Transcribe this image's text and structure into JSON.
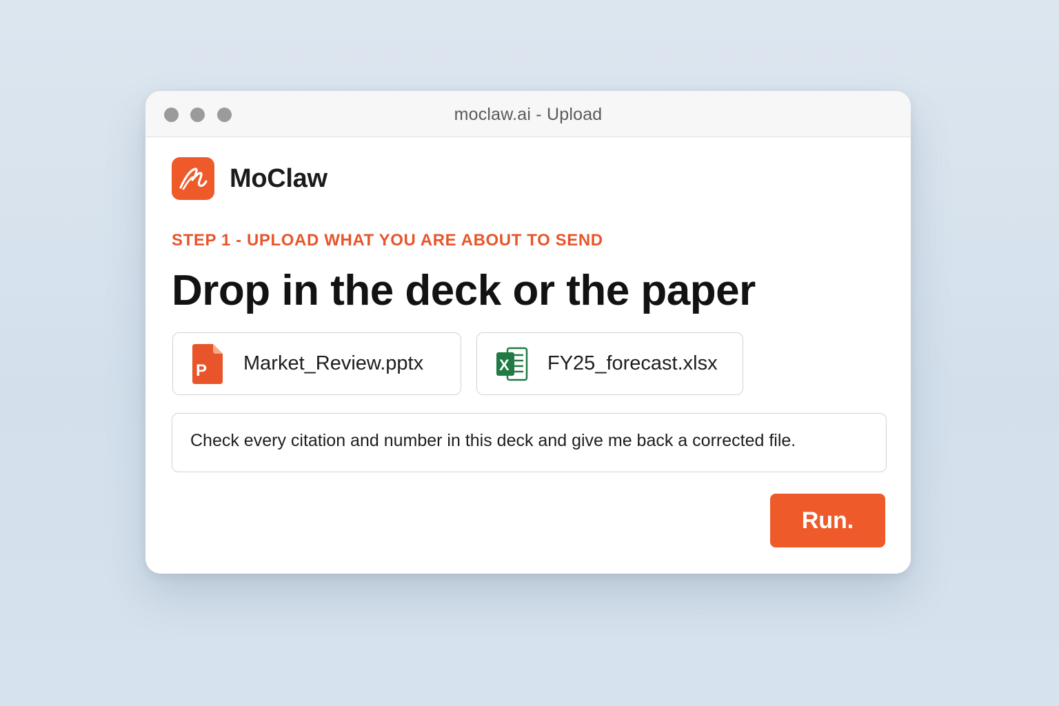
{
  "window": {
    "title": "moclaw.ai - Upload",
    "controls": [
      "close",
      "minimize",
      "zoom"
    ]
  },
  "brand": {
    "name": "MoClaw",
    "logo_icon": "moclaw-logo-icon",
    "accent_color": "#ee5a2a"
  },
  "step": {
    "label": "STEP 1 - UPLOAD WHAT YOU ARE ABOUT TO SEND",
    "color": "#e8552a"
  },
  "headline": "Drop in the deck or the paper",
  "files": [
    {
      "name": "Market_Review.pptx",
      "icon": "powerpoint-file-icon",
      "icon_color": "#e8552a"
    },
    {
      "name": "FY25_forecast.xlsx",
      "icon": "excel-file-icon",
      "icon_color": "#1f7a43"
    }
  ],
  "prompt": {
    "value": "Check every citation and number in this deck and give me back a corrected file."
  },
  "run_button": {
    "label": "Run.",
    "color": "#ee5a2a"
  }
}
